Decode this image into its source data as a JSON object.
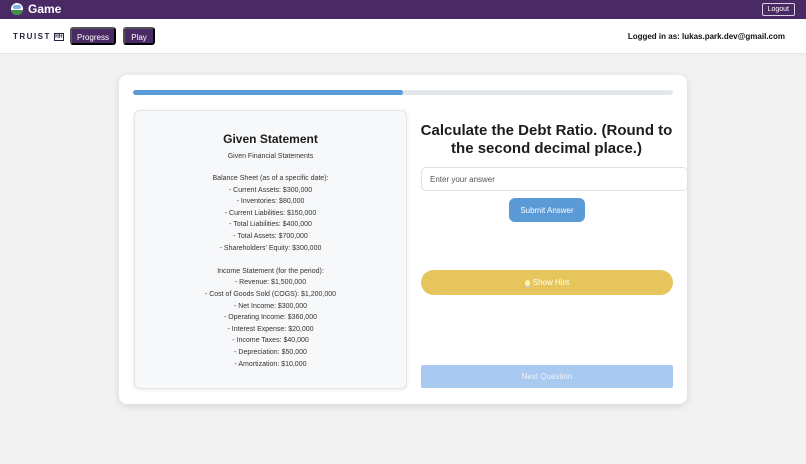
{
  "app": {
    "title": "Game",
    "logout_label": "Logout"
  },
  "nav": {
    "brand": "TRUIST",
    "brand_mark": "HH",
    "progress_label": "Progress",
    "play_label": "Play",
    "logged_in_text": "Logged in as: lukas.park.dev@gmail.com"
  },
  "progress": {
    "fraction": 0.5
  },
  "statement": {
    "title": "Given Statement",
    "subtitle": "Given Financial Statements",
    "balance_sheet": [
      "Balance Sheet (as of a specific date):",
      "- Current Assets: $300,000",
      "- Inventories: $80,000",
      "- Current Liabilities: $150,000",
      "- Total Liabilities: $400,000",
      "- Total Assets: $700,000",
      "- Shareholders' Equity: $300,000"
    ],
    "income_statement": [
      "Income Statement (for the period):",
      "- Revenue: $1,500,000",
      "- Cost of Goods Sold (COGS): $1,200,000",
      "- Net Income: $300,000",
      "- Operating Income: $360,000",
      "- Interest Expense: $20,000",
      "- Income Taxes: $40,000",
      "- Depreciation: $50,000",
      "- Amortization: $10,000"
    ]
  },
  "question": {
    "text": "Calculate the Debt Ratio. (Round to the second decimal place.)",
    "answer_value": "",
    "answer_placeholder": "Enter your answer",
    "submit_label": "Submit Answer",
    "hint_label": "Show Hint",
    "next_label": "Next Question"
  },
  "colors": {
    "header_purple": "#4a2a64",
    "primary_blue": "#5a9ad6",
    "hint_yellow": "#e6c65c",
    "next_disabled": "#a8c9f0"
  }
}
